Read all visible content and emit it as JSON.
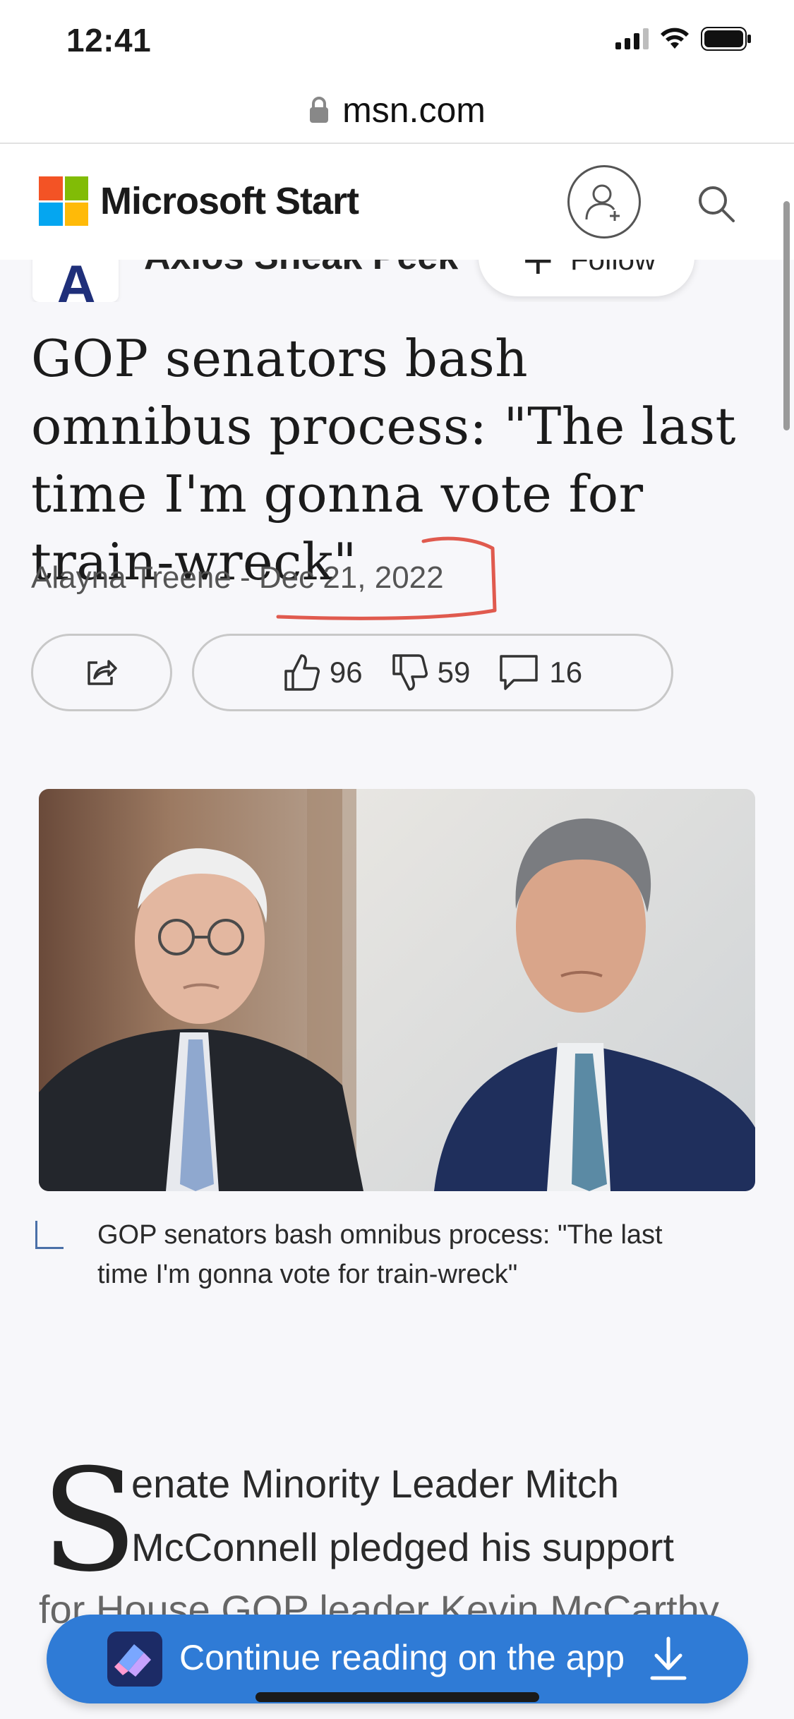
{
  "status_bar": {
    "time": "12:41"
  },
  "browser": {
    "url": "msn.com",
    "icons": [
      "lock-icon"
    ]
  },
  "header": {
    "brand": "Microsoft Start",
    "logo_colors": [
      "#f35325",
      "#81bc06",
      "#05a6f0",
      "#ffba08"
    ],
    "icons": [
      "account-add-icon",
      "search-icon"
    ]
  },
  "publisher": {
    "name": "Axios Sneak Peek",
    "follow_label": "Follow",
    "logo_mark": "A"
  },
  "article": {
    "headline": "GOP senators bash omnibus process: \"The last time I'm gonna vote for train-wreck\"",
    "author": "Alayna Treene",
    "separator": " - ",
    "date": "Dec 21, 2022",
    "annotation_color": "#e05a4e"
  },
  "actions": {
    "likes": "96",
    "dislikes": "59",
    "comments": "16"
  },
  "image": {
    "caption": "GOP senators bash omnibus process: \"The last time I'm gonna vote for train-wreck\""
  },
  "body": {
    "drop_cap": "S",
    "line1": "enate Minority Leader Mitch",
    "line2": "McConnell pledged his support",
    "line3": "for House GOP leader Kevin McCarthy"
  },
  "cta": {
    "label": "Continue reading on the app",
    "color": "#2f7bd6"
  }
}
